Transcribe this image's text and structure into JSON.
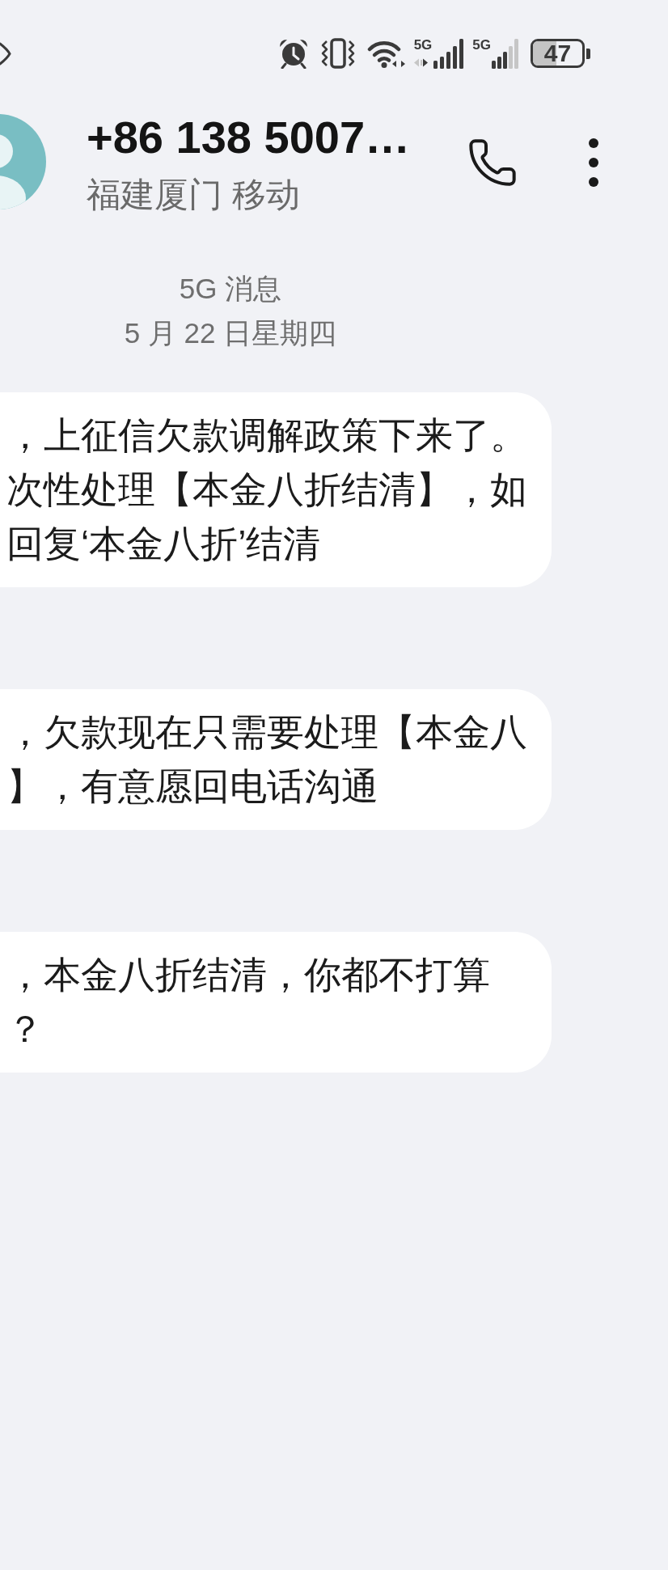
{
  "status_bar": {
    "sim_1_network": "5G",
    "sim_2_network": "5G",
    "battery": "47"
  },
  "header": {
    "title": "+86 138 5007…",
    "subtitle": "福建厦门 移动"
  },
  "thread": {
    "channel": "5G 消息",
    "date": "5 月 22 日星期四"
  },
  "messages": [
    {
      "lines": [
        "，上征信欠款调解政策下来了。",
        "次性处理【本金八折结清】，如",
        "回复‘本金八折’结清"
      ]
    },
    {
      "lines": [
        "，欠款现在只需要处理【本金八",
        "】，有意愿回电话沟通"
      ]
    },
    {
      "lines": [
        "，本金八折结清，你都不打算",
        "？"
      ]
    }
  ]
}
